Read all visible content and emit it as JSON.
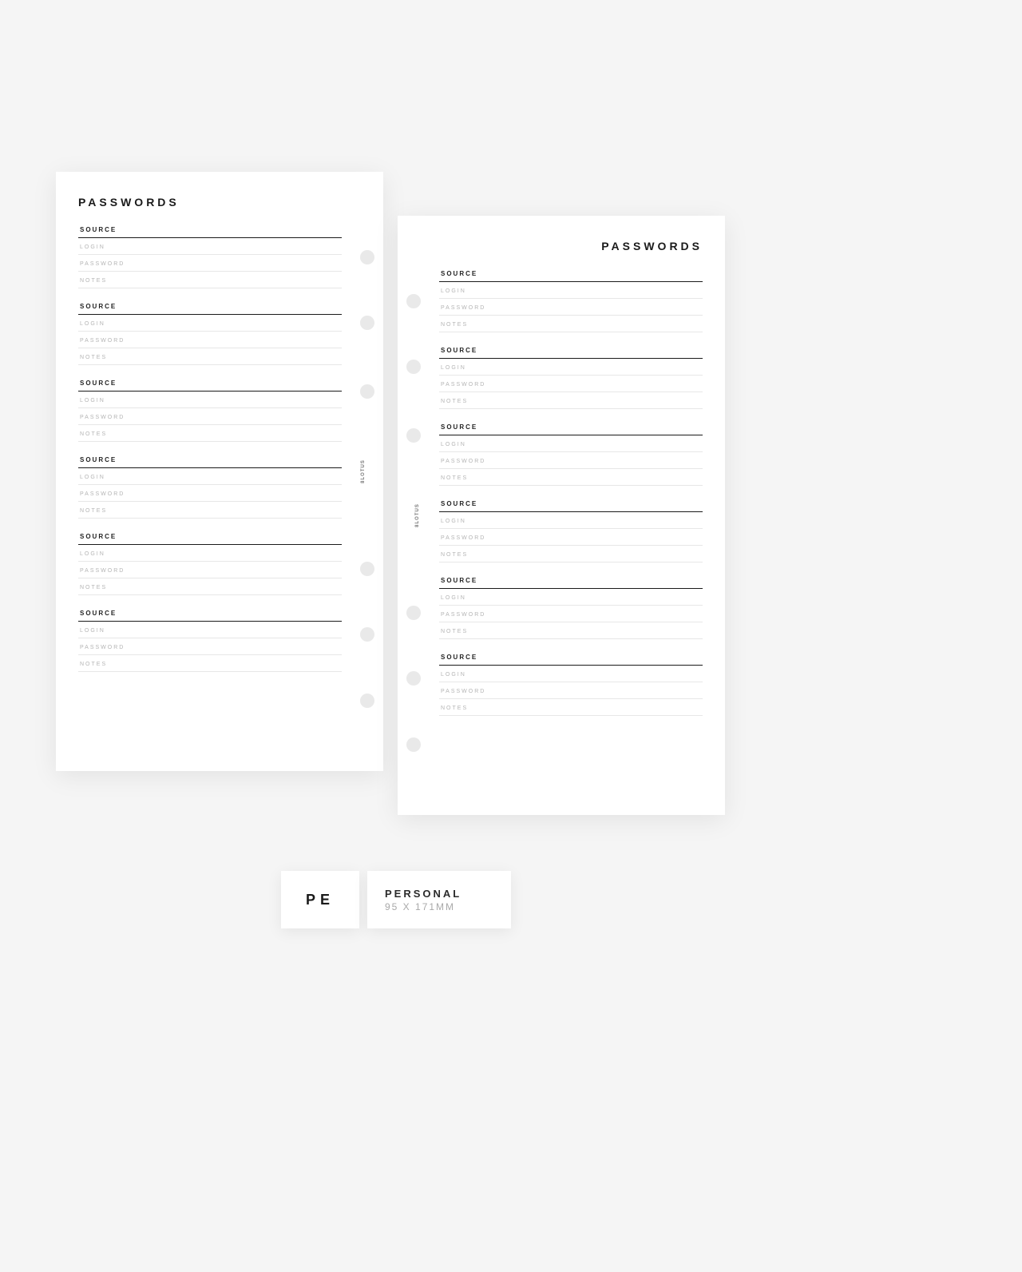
{
  "title": "PASSWORDS",
  "labels": {
    "source": "SOURCE",
    "login": "LOGIN",
    "password": "PASSWORD",
    "notes": "NOTES"
  },
  "brand": "8LOTUS",
  "entries_per_page": 6,
  "hole_positions_pct": [
    13,
    24,
    35.5,
    65,
    76,
    87
  ],
  "size_chip": {
    "code": "PE",
    "name": "PERSONAL",
    "dims": "95 X 171MM"
  }
}
